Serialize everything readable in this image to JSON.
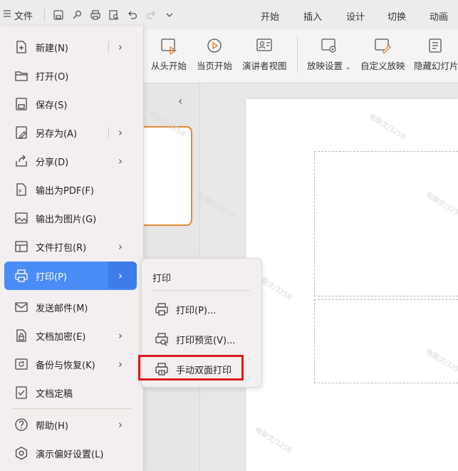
{
  "topbar": {
    "file_label": "文件",
    "tabs": [
      {
        "label": "开始"
      },
      {
        "label": "插入"
      },
      {
        "label": "设计"
      },
      {
        "label": "切换"
      },
      {
        "label": "动画"
      }
    ]
  },
  "ribbon": {
    "buttons": [
      {
        "label": "从头开始",
        "icon": "play-from-start-icon"
      },
      {
        "label": "当页开始",
        "icon": "play-current-icon"
      },
      {
        "label": "演讲者视图",
        "icon": "presenter-view-icon"
      },
      {
        "label": "放映设置",
        "icon": "slideshow-settings-icon"
      },
      {
        "label": "自定义放映",
        "icon": "custom-show-icon"
      },
      {
        "label": "隐藏幻灯片",
        "icon": "hide-slide-icon"
      }
    ]
  },
  "file_menu": {
    "items": [
      {
        "label": "新建(N)",
        "icon": "new-file-icon",
        "submenu": true
      },
      {
        "label": "打开(O)",
        "icon": "open-folder-icon",
        "submenu": false
      },
      {
        "label": "保存(S)",
        "icon": "save-icon",
        "submenu": false
      },
      {
        "label": "另存为(A)",
        "icon": "save-as-icon",
        "submenu": true
      },
      {
        "label": "分享(D)",
        "icon": "share-icon",
        "submenu": true
      },
      {
        "label": "输出为PDF(F)",
        "icon": "export-pdf-icon",
        "submenu": false
      },
      {
        "label": "输出为图片(G)",
        "icon": "export-image-icon",
        "submenu": false
      },
      {
        "label": "文件打包(R)",
        "icon": "package-icon",
        "submenu": true
      },
      {
        "label": "打印(P)",
        "icon": "printer-icon",
        "submenu": true,
        "active": true
      },
      {
        "label": "发送邮件(M)",
        "icon": "mail-icon",
        "submenu": false
      },
      {
        "label": "文档加密(E)",
        "icon": "encrypt-icon",
        "submenu": true
      },
      {
        "label": "备份与恢复(K)",
        "icon": "backup-icon",
        "submenu": true
      },
      {
        "label": "文档定稿",
        "icon": "finalize-icon",
        "submenu": false
      },
      {
        "label": "帮助(H)",
        "icon": "help-icon",
        "submenu": true
      },
      {
        "label": "演示偏好设置(L)",
        "icon": "settings-icon",
        "submenu": false
      }
    ]
  },
  "print_submenu": {
    "title": "打印",
    "items": [
      {
        "label": "打印(P)...",
        "icon": "printer-icon"
      },
      {
        "label": "打印预览(V)...",
        "icon": "print-preview-icon"
      },
      {
        "label": "手动双面打印",
        "icon": "duplex-print-icon",
        "highlighted": true
      }
    ]
  },
  "watermark_text": "电脑文/3258",
  "colors": {
    "active_item": "#4a8cf5",
    "highlight_border": "#e0191f",
    "thumbnail_border": "#e08a36"
  }
}
